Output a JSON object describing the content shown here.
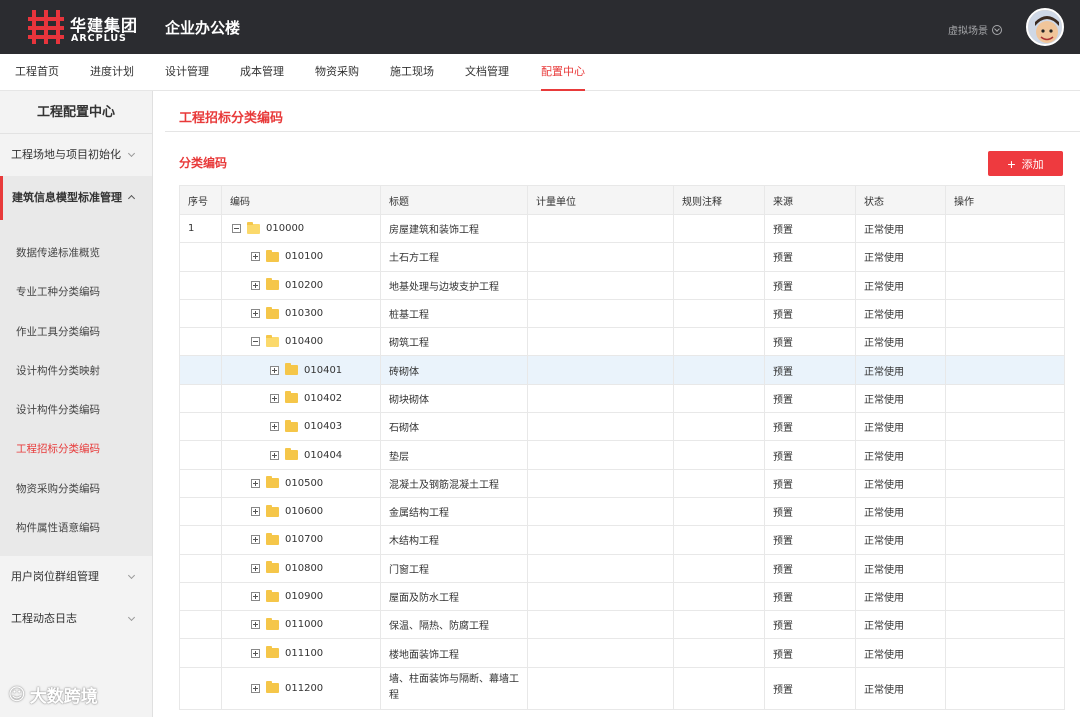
{
  "header": {
    "brand_cn": "华建集团",
    "brand_en": "ARCPLUS",
    "app_title": "企业办公楼",
    "scene_label": "虚拟场景"
  },
  "nav": [
    "工程首页",
    "进度计划",
    "设计管理",
    "成本管理",
    "物资采购",
    "施工现场",
    "文档管理",
    "配置中心"
  ],
  "nav_active": "配置中心",
  "sidebar": {
    "title": "工程配置中心",
    "group1": "工程场地与项目初始化",
    "group2": "建筑信息模型标准管理",
    "sub_items": [
      "数据传递标准概览",
      "专业工种分类编码",
      "作业工具分类编码",
      "设计构件分类映射",
      "设计构件分类编码",
      "工程招标分类编码",
      "物资采购分类编码",
      "构件属性语意编码"
    ],
    "active_sub": "工程招标分类编码",
    "group3": "用户岗位群组管理",
    "group4": "工程动态日志"
  },
  "main": {
    "page_title": "工程招标分类编码",
    "section_title": "分类编码",
    "add_button": "添加"
  },
  "table": {
    "headers": [
      "序号",
      "编码",
      "标题",
      "计量单位",
      "规则注释",
      "来源",
      "状态",
      "操作"
    ],
    "rows": [
      {
        "idx": "1",
        "code": "010000",
        "title": "房屋建筑和装饰工程",
        "source": "预置",
        "status": "正常使用"
      },
      {
        "idx": "",
        "code": "010100",
        "title": "土石方工程",
        "source": "预置",
        "status": "正常使用"
      },
      {
        "idx": "",
        "code": "010200",
        "title": "地基处理与边坡支护工程",
        "source": "预置",
        "status": "正常使用"
      },
      {
        "idx": "",
        "code": "010300",
        "title": "桩基工程",
        "source": "预置",
        "status": "正常使用"
      },
      {
        "idx": "",
        "code": "010400",
        "title": "砌筑工程",
        "source": "预置",
        "status": "正常使用"
      },
      {
        "idx": "",
        "code": "010401",
        "title": "砖砌体",
        "source": "预置",
        "status": "正常使用"
      },
      {
        "idx": "",
        "code": "010402",
        "title": "砌块砌体",
        "source": "预置",
        "status": "正常使用"
      },
      {
        "idx": "",
        "code": "010403",
        "title": "石砌体",
        "source": "预置",
        "status": "正常使用"
      },
      {
        "idx": "",
        "code": "010404",
        "title": "垫层",
        "source": "预置",
        "status": "正常使用"
      },
      {
        "idx": "",
        "code": "010500",
        "title": "混凝土及钢筋混凝土工程",
        "source": "预置",
        "status": "正常使用"
      },
      {
        "idx": "",
        "code": "010600",
        "title": "金属结构工程",
        "source": "预置",
        "status": "正常使用"
      },
      {
        "idx": "",
        "code": "010700",
        "title": "木结构工程",
        "source": "预置",
        "status": "正常使用"
      },
      {
        "idx": "",
        "code": "010800",
        "title": "门窗工程",
        "source": "预置",
        "status": "正常使用"
      },
      {
        "idx": "",
        "code": "010900",
        "title": "屋面及防水工程",
        "source": "预置",
        "status": "正常使用"
      },
      {
        "idx": "",
        "code": "011000",
        "title": "保温、隔热、防腐工程",
        "source": "预置",
        "status": "正常使用"
      },
      {
        "idx": "",
        "code": "011100",
        "title": "楼地面装饰工程",
        "source": "预置",
        "status": "正常使用"
      },
      {
        "idx": "",
        "code": "011200",
        "title": "墙、柱面装饰与隔断、幕墙工程",
        "source": "预置",
        "status": "正常使用"
      }
    ]
  },
  "watermark": "大数跨境",
  "colors": {
    "accent": "#e83a3a",
    "header_bg": "#2b2c30",
    "sidebar_bg": "#f3f3f3",
    "row_highlight": "#eaf3fb"
  }
}
